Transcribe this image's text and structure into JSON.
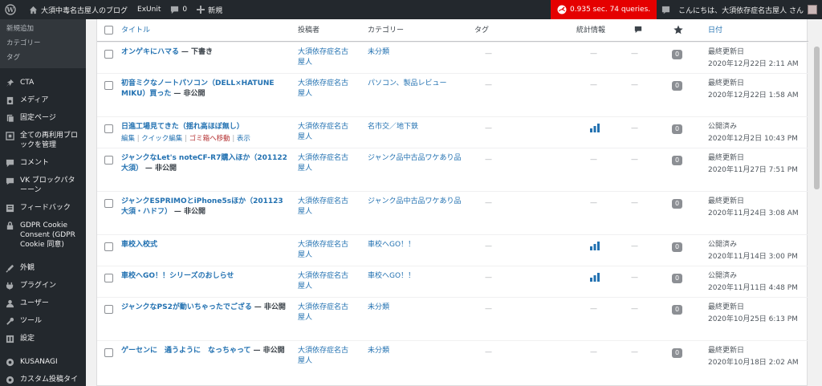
{
  "adminbar": {
    "site_name": "大須中毒名古屋人のブログ",
    "exunit": "ExUnit",
    "comments_count": "0",
    "new_label": "新規",
    "perf": "0.935 sec. 74 queries.",
    "greeting": "こんにちは、大須依存症名古屋人 さん"
  },
  "sidebar": {
    "submenu": [
      "新規追加",
      "カテゴリー",
      "タグ"
    ],
    "menu": [
      {
        "label": "CTA",
        "icon": "pin-icon"
      },
      {
        "label": "メディア",
        "icon": "media-icon"
      },
      {
        "label": "固定ページ",
        "icon": "page-icon"
      },
      {
        "label": "全ての再利用ブロックを管理",
        "icon": "block-icon"
      },
      {
        "label": "コメント",
        "icon": "comment-icon"
      },
      {
        "label": "VK ブロックパターーン",
        "icon": "pattern-icon"
      },
      {
        "label": "フィードバック",
        "icon": "feedback-icon"
      },
      {
        "label": "GDPR Cookie Consent (GDPR Cookie 同意)",
        "icon": "cookie-icon"
      },
      {
        "label": "外観",
        "icon": "appearance-icon"
      },
      {
        "label": "プラグイン",
        "icon": "plugin-icon"
      },
      {
        "label": "ユーザー",
        "icon": "user-icon"
      },
      {
        "label": "ツール",
        "icon": "tool-icon"
      },
      {
        "label": "設定",
        "icon": "settings-icon"
      },
      {
        "label": "KUSANAGI",
        "icon": "kusanagi-icon"
      },
      {
        "label": "カスタム投稿タイ",
        "icon": "custom-post-icon"
      }
    ]
  },
  "table": {
    "headers": {
      "title": "タイトル",
      "author": "投稿者",
      "category": "カテゴリー",
      "tag": "タグ",
      "stats": "統計情報",
      "date": "日付"
    },
    "row_actions": {
      "edit": "編集",
      "quick_edit": "クイック編集",
      "trash": "ゴミ箱へ移動",
      "view": "表示",
      "sep": "|"
    },
    "dash": "—",
    "rows": [
      {
        "title": "オンゲキにハマる",
        "state": "— 下書き",
        "author": "大須依存症名古屋人",
        "category": "未分類",
        "tag": "—",
        "stats": "—",
        "comments": "—",
        "count": "0",
        "date_status": "最終更新日",
        "date": "2020年12月22日 2:11 AM",
        "has_chart": false
      },
      {
        "title": "初音ミクなノートパソコン（DELL×HATUNE MIKU）買った",
        "state": "— 非公開",
        "author": "大須依存症名古屋人",
        "category": "パソコン、製品レビュー",
        "tag": "—",
        "stats": "—",
        "comments": "—",
        "count": "0",
        "date_status": "最終更新日",
        "date": "2020年12月22日 1:58 AM",
        "has_chart": false
      },
      {
        "title": "日進工場見てきた（揺れ高ほぼ無し）",
        "state": "",
        "author": "大須依存症名古屋人",
        "category": "名市交／地下鉄",
        "tag": "—",
        "stats": "",
        "comments": "—",
        "count": "0",
        "date_status": "公開済み",
        "date": "2020年12月2日 10:43 PM",
        "has_chart": true
      },
      {
        "title": "ジャンクなLet's noteCF-R7購入ほか（201122大須）",
        "state": "— 非公開",
        "author": "大須依存症名古屋人",
        "category": "ジャンク品中古品ワケあり品",
        "tag": "—",
        "stats": "—",
        "comments": "—",
        "count": "0",
        "date_status": "最終更新日",
        "date": "2020年11月27日 7:51 PM",
        "has_chart": false
      },
      {
        "title": "ジャンクESPRIMOとiPhone5sほか（201123大須・ハドフ）",
        "state": "— 非公開",
        "author": "大須依存症名古屋人",
        "category": "ジャンク品中古品ワケあり品",
        "tag": "—",
        "stats": "—",
        "comments": "—",
        "count": "0",
        "date_status": "最終更新日",
        "date": "2020年11月24日 3:08 AM",
        "has_chart": false
      },
      {
        "title": "車校入校式",
        "state": "",
        "author": "大須依存症名古屋人",
        "category": "車校へGO！！",
        "tag": "—",
        "stats": "",
        "comments": "—",
        "count": "0",
        "date_status": "公開済み",
        "date": "2020年11月14日 3:00 PM",
        "has_chart": true
      },
      {
        "title": "車校へGO！！シリーズのおしらせ",
        "state": "",
        "author": "大須依存症名古屋人",
        "category": "車校へGO！！",
        "tag": "—",
        "stats": "",
        "comments": "—",
        "count": "0",
        "date_status": "公開済み",
        "date": "2020年11月11日 4:48 PM",
        "has_chart": true
      },
      {
        "title": "ジャンクなPS2が動いちゃったでござる",
        "state": "— 非公開",
        "author": "大須依存症名古屋人",
        "category": "未分類",
        "tag": "—",
        "stats": "—",
        "comments": "—",
        "count": "0",
        "date_status": "最終更新日",
        "date": "2020年10月25日 6:13 PM",
        "has_chart": false
      },
      {
        "title": "ゲーセンに　通うように　なっちゃって",
        "state": "— 非公開",
        "author": "大須依存症名古屋人",
        "category": "未分類",
        "tag": "—",
        "stats": "—",
        "comments": "—",
        "count": "0",
        "date_status": "最終更新日",
        "date": "2020年10月18日 2:02 AM",
        "has_chart": false
      }
    ]
  },
  "colors": {
    "adminbar_bg": "#23282d",
    "link": "#2271b1",
    "perf_bg": "#e50000",
    "trash": "#b32d2e",
    "badge": "#8c8f94"
  }
}
